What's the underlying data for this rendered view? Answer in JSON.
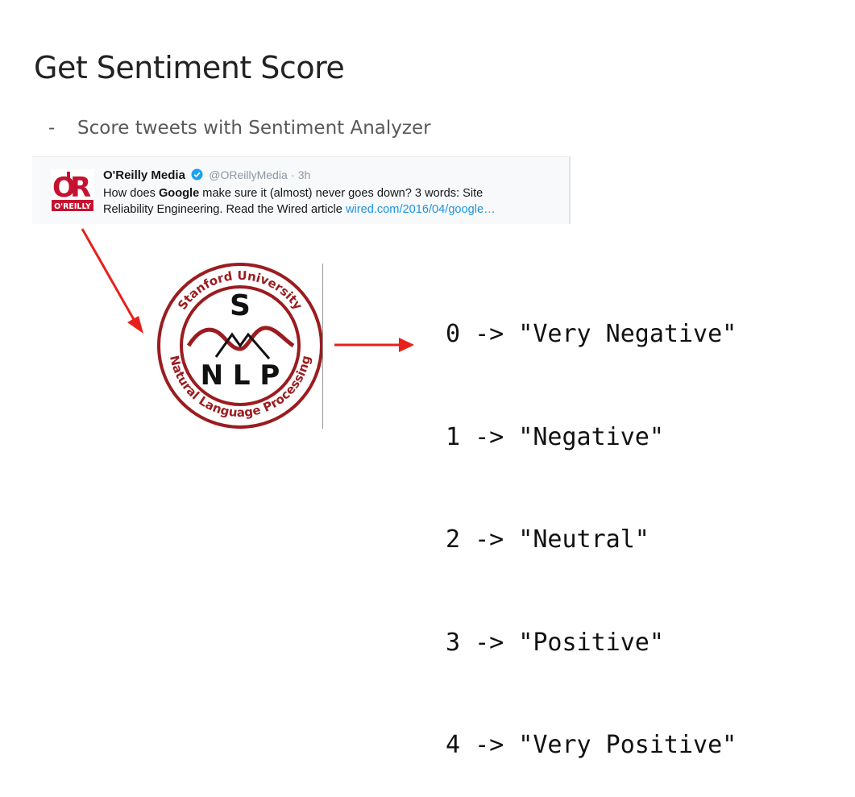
{
  "slide": {
    "title": "Get Sentiment Score",
    "bullet_marker": "-",
    "bullet": "Score tweets with Sentiment Analyzer"
  },
  "tweet": {
    "author": "O'Reilly Media",
    "handle": "@OReillyMedia",
    "separator": "·",
    "time": "3h",
    "text_part1": "How does ",
    "text_bold": "Google",
    "text_part2": " make sure it (almost) never goes down? 3 words: Site",
    "text_line2": "Reliability Engineering. Read the Wired article ",
    "link": "wired.com/2016/04/google…",
    "avatar_logo_text": "O'REILLY",
    "verified_icon": "verified-badge-icon"
  },
  "logo": {
    "top_text": "Stanford University",
    "bottom_text": "Natural Language Processing",
    "letter_s": "S",
    "letters_nlp": "N L P"
  },
  "scores": [
    "0 -> \"Very Negative\"",
    "1 -> \"Negative\"",
    "2 -> \"Neutral\"",
    "3 -> \"Positive\"",
    "4 -> \"Very Positive\""
  ],
  "colors": {
    "arrow": "#e8201a",
    "logo_red": "#9b1c1f",
    "oreilly_red": "#c41230",
    "link": "#1b95e0"
  }
}
